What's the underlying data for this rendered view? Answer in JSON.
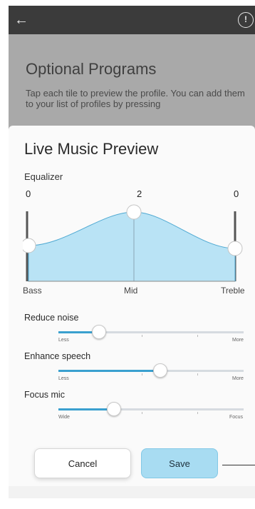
{
  "app": {
    "back_icon": "arrow-left-icon",
    "info_icon": "info-circle-icon"
  },
  "background": {
    "title": "Optional Programs",
    "description": "Tap each tile to preview the profile. You can add them to your list of profiles by pressing"
  },
  "preview": {
    "title": "Live Music Preview",
    "equalizer_label": "Equalizer",
    "bands": [
      {
        "label": "Bass",
        "value": "0"
      },
      {
        "label": "Mid",
        "value": "2"
      },
      {
        "label": "Treble",
        "value": "0"
      }
    ],
    "sliders": [
      {
        "label": "Reduce noise",
        "left": "Less",
        "right": "More",
        "level": 0.22
      },
      {
        "label": "Enhance speech",
        "left": "Less",
        "right": "More",
        "level": 0.55
      },
      {
        "label": "Focus mic",
        "left": "Wide",
        "right": "Focus",
        "level": 0.3
      }
    ],
    "cancel_label": "Cancel",
    "save_label": "Save"
  },
  "colors": {
    "accent": "#3aa0cf",
    "fill": "#b9e3f5",
    "topbar": "#3b3b3b"
  }
}
